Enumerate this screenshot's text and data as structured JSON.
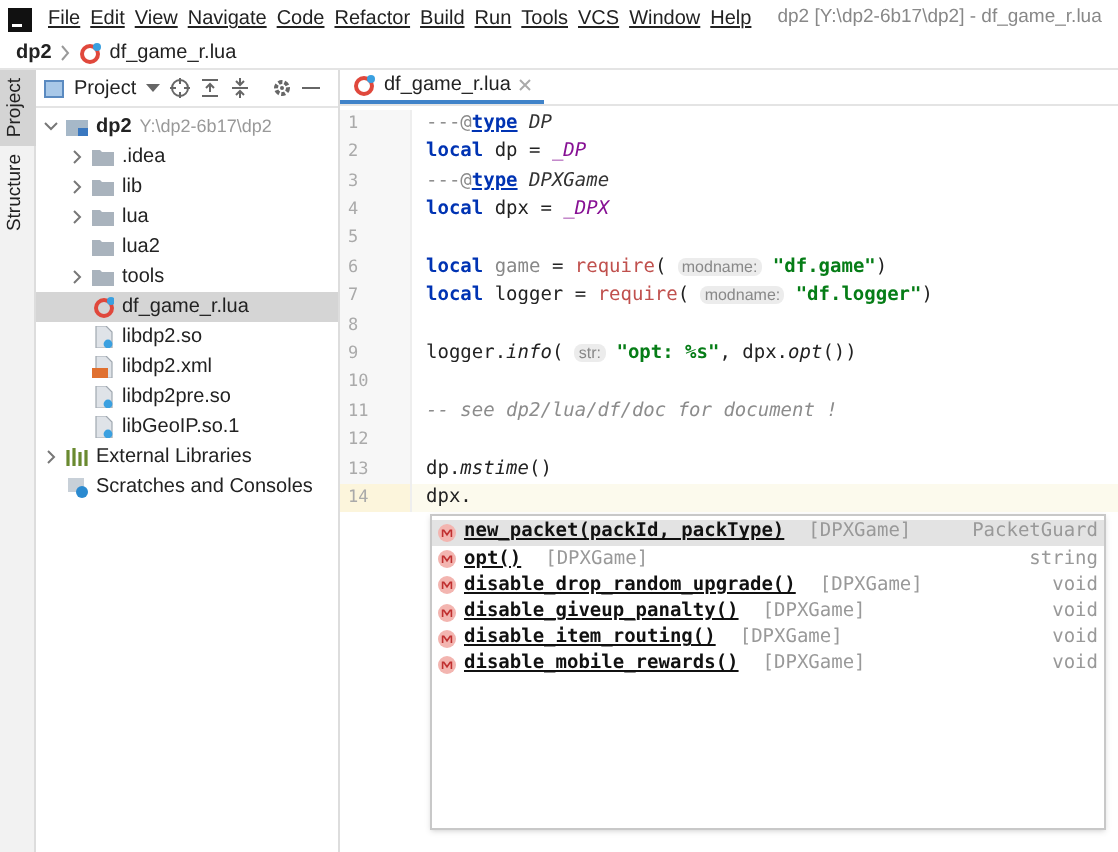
{
  "menu_bar": {
    "items": [
      "File",
      "Edit",
      "View",
      "Navigate",
      "Code",
      "Refactor",
      "Build",
      "Run",
      "Tools",
      "VCS",
      "Window",
      "Help"
    ],
    "title": "dp2 [Y:\\dp2-6b17\\dp2] - df_game_r.lua"
  },
  "breadcrumb": [
    "dp2",
    "df_game_r.lua"
  ],
  "side_tabs": [
    {
      "label": "Project",
      "selected": true
    },
    {
      "label": "Structure",
      "selected": false
    }
  ],
  "project_toolbar": {
    "label": "Project"
  },
  "tree": [
    {
      "label": "dp2",
      "path": "Y:\\dp2-6b17\\dp2",
      "kind": "module",
      "expanded": true,
      "selected": false,
      "children": [
        {
          "label": ".idea",
          "kind": "folder",
          "expanded": false,
          "selected": false
        },
        {
          "label": "lib",
          "kind": "folder",
          "expanded": false,
          "selected": false
        },
        {
          "label": "lua",
          "kind": "folder",
          "expanded": false,
          "selected": false
        },
        {
          "label": "lua2",
          "kind": "folder",
          "selected": false
        },
        {
          "label": "tools",
          "kind": "folder",
          "expanded": false,
          "selected": false
        },
        {
          "label": "df_game_r.lua",
          "kind": "lua",
          "selected": true
        },
        {
          "label": "libdp2.so",
          "kind": "binary",
          "selected": false
        },
        {
          "label": "libdp2.xml",
          "kind": "xml",
          "selected": false
        },
        {
          "label": "libdp2pre.so",
          "kind": "binary",
          "selected": false
        },
        {
          "label": "libGeoIP.so.1",
          "kind": "binary",
          "selected": false
        }
      ]
    },
    {
      "label": "External Libraries",
      "kind": "library",
      "expanded": false,
      "selected": false
    },
    {
      "label": "Scratches and Consoles",
      "kind": "scratches",
      "selected": false
    }
  ],
  "editor_tabs": [
    {
      "label": "df_game_r.lua",
      "selected": true
    }
  ],
  "code_lines": [
    {
      "number": "1",
      "current": false,
      "tokens": [
        {
          "kind": "comment",
          "t": "---@"
        },
        {
          "kind": "doctag",
          "t": "type"
        },
        {
          "kind": "type",
          "t": " DP"
        }
      ]
    },
    {
      "number": "2",
      "current": false,
      "tokens": [
        {
          "kind": "keyword",
          "t": "local"
        },
        {
          "kind": "plain",
          "t": " dp = "
        },
        {
          "kind": "global",
          "t": "_DP"
        }
      ]
    },
    {
      "number": "3",
      "current": false,
      "tokens": [
        {
          "kind": "comment",
          "t": "---@"
        },
        {
          "kind": "doctag",
          "t": "type"
        },
        {
          "kind": "type",
          "t": " DPXGame"
        }
      ]
    },
    {
      "number": "4",
      "current": false,
      "tokens": [
        {
          "kind": "keyword",
          "t": "local"
        },
        {
          "kind": "plain",
          "t": " dpx = "
        },
        {
          "kind": "global",
          "t": "_DPX"
        }
      ]
    },
    {
      "number": "5",
      "current": false
    },
    {
      "number": "6",
      "current": false,
      "tokens": [
        {
          "kind": "keyword",
          "t": "local"
        },
        {
          "kind": "unused",
          "t": " game"
        },
        {
          "kind": "plain",
          "t": " = "
        },
        {
          "kind": "require",
          "t": "require"
        },
        {
          "kind": "plain",
          "t": "( "
        },
        {
          "kind": "hint",
          "t": "modname:"
        },
        {
          "kind": "string",
          "t": " \"df.game\""
        },
        {
          "kind": "plain",
          "t": ")"
        }
      ]
    },
    {
      "number": "7",
      "current": false,
      "tokens": [
        {
          "kind": "keyword",
          "t": "local"
        },
        {
          "kind": "plain",
          "t": " logger = "
        },
        {
          "kind": "require",
          "t": "require"
        },
        {
          "kind": "plain",
          "t": "( "
        },
        {
          "kind": "hint",
          "t": "modname:"
        },
        {
          "kind": "string",
          "t": " \"df.logger\""
        },
        {
          "kind": "plain",
          "t": ")"
        }
      ]
    },
    {
      "number": "8",
      "current": false
    },
    {
      "number": "9",
      "current": false,
      "tokens": [
        {
          "kind": "plain",
          "t": "logger."
        },
        {
          "kind": "method",
          "t": "info"
        },
        {
          "kind": "plain",
          "t": "( "
        },
        {
          "kind": "hint",
          "t": "str:"
        },
        {
          "kind": "string",
          "t": " \"opt: %s\""
        },
        {
          "kind": "plain",
          "t": ", dpx."
        },
        {
          "kind": "method",
          "t": "opt"
        },
        {
          "kind": "plain",
          "t": "())"
        }
      ]
    },
    {
      "number": "10",
      "current": false
    },
    {
      "number": "11",
      "current": false,
      "tokens": [
        {
          "kind": "linecomment",
          "t": "-- see dp2/lua/df/doc for document !"
        }
      ]
    },
    {
      "number": "12",
      "current": false
    },
    {
      "number": "13",
      "current": false,
      "tokens": [
        {
          "kind": "plain",
          "t": "dp."
        },
        {
          "kind": "method",
          "t": "mstime"
        },
        {
          "kind": "plain",
          "t": "()"
        }
      ]
    },
    {
      "number": "14",
      "current": true,
      "tokens": [
        {
          "kind": "plain",
          "t": "dpx."
        }
      ]
    }
  ],
  "completion": [
    {
      "name": "new_packet(packId, packType)",
      "owner": "[DPXGame]",
      "type": "PacketGuard",
      "selected": true
    },
    {
      "name": "opt()",
      "owner": "[DPXGame]",
      "type": "string",
      "selected": false
    },
    {
      "name": "disable_drop_random_upgrade()",
      "owner": "[DPXGame]",
      "type": "void",
      "selected": false
    },
    {
      "name": "disable_giveup_panalty()",
      "owner": "[DPXGame]",
      "type": "void",
      "selected": false
    },
    {
      "name": "disable_item_routing()",
      "owner": "[DPXGame]",
      "type": "void",
      "selected": false
    },
    {
      "name": "disable_mobile_rewards()",
      "owner": "[DPXGame]",
      "type": "void",
      "selected": false
    }
  ]
}
